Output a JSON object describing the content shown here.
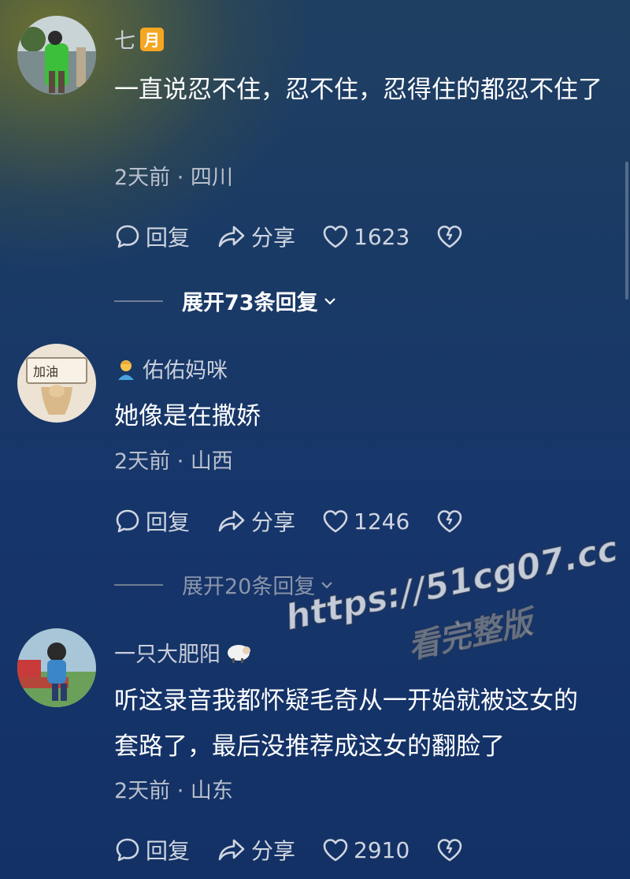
{
  "comments": [
    {
      "username": "七",
      "badge": "月",
      "text": "一直说忍不住，忍不住，忍得住的都忍不住了",
      "meta": "2天前 · 四川",
      "reply_label": "回复",
      "share_label": "分享",
      "likes": "1623",
      "expand_label": "展开73条回复"
    },
    {
      "username": "佑佑妈咪",
      "badge_icon": "person-emoji-icon",
      "avatar_text": "加油",
      "text": "她像是在撒娇",
      "meta": "2天前 · 山西",
      "reply_label": "回复",
      "share_label": "分享",
      "likes": "1246",
      "expand_label": "展开20条回复"
    },
    {
      "username": "一只大肥阳",
      "badge_icon": "sheep-emoji-icon",
      "text_line1": "听这录音我都怀疑毛奇从一开始就被这女的",
      "text_line2": "套路了，最后没推荐成这女的翻脸了",
      "meta": "2天前 · 山东",
      "reply_label": "回复",
      "share_label": "分享",
      "likes": "2910"
    }
  ],
  "watermark": {
    "url": "https://51cg07.cc",
    "subtitle": "看完整版"
  },
  "colors": {
    "badge": "#f5a623",
    "text_primary": "#ffffff",
    "text_secondary": "#b9c0cd"
  }
}
